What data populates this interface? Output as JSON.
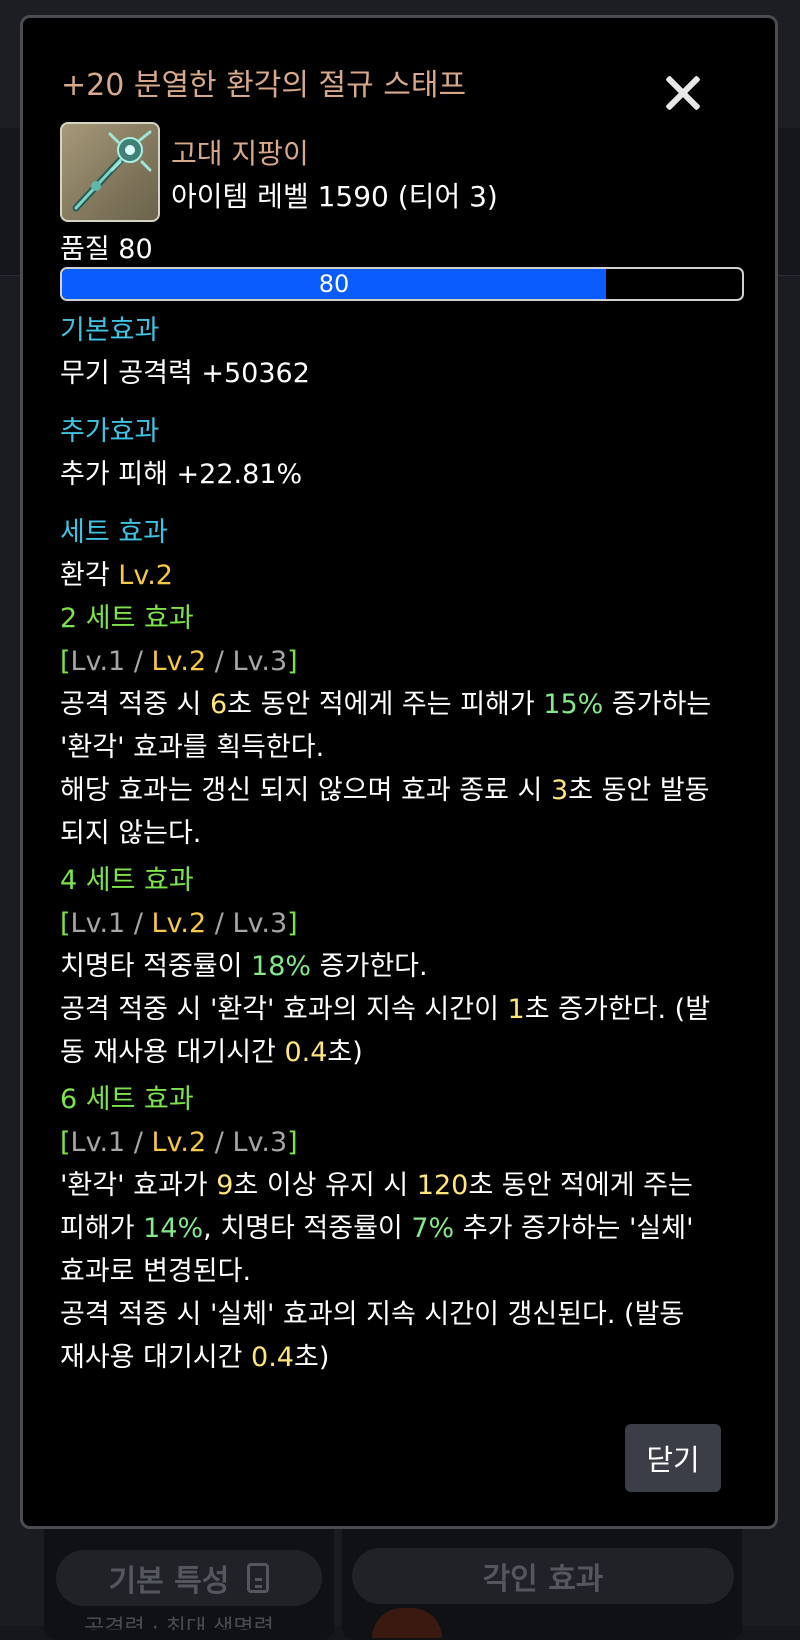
{
  "background": {
    "tab_basic_traits": "기본 특성",
    "tab_engraving": "각인 효과",
    "peek_text": "공격력 · 최대 생명력"
  },
  "tooltip": {
    "title": "+20 분열한 환각의 절규 스태프",
    "item_type": "고대 지팡이",
    "item_level": "아이템 레벨 1590 (티어 3)",
    "quality_label": "품질 80",
    "quality_value": "80",
    "quality_percent": 80,
    "basic_effect": {
      "title": "기본효과",
      "line": "무기 공격력 +50362"
    },
    "extra_effect": {
      "title": "추가효과",
      "line": "추가 피해 +22.81%"
    },
    "set_effect": {
      "title": "세트 효과",
      "set_name": "환각",
      "set_level": "Lv.2",
      "levels": {
        "open": "[",
        "lv1": "Lv.1",
        "sep": " / ",
        "lv2": "Lv.2",
        "lv3": "Lv.3",
        "close": "]"
      },
      "set2": {
        "title": "2 세트 효과",
        "t1": "공격 적중 시 ",
        "n1": "6",
        "t2": "초 동안 적에게 주는 피해가 ",
        "n2": "15%",
        "t3": " 증가하는",
        "t4": "'환각' 효과를 획득한다.",
        "t5": "해당 효과는 갱신 되지 않으며 효과 종료 시 ",
        "n3": "3",
        "t6": "초 동안 발동",
        "t7": "되지 않는다."
      },
      "set4": {
        "title": "4 세트 효과",
        "t1": "치명타 적중률이 ",
        "n1": "18%",
        "t2": " 증가한다.",
        "t3": "공격 적중 시 '환각' 효과의 지속 시간이 ",
        "n2": "1",
        "t4": "초 증가한다. (발",
        "t5": "동 재사용 대기시간 ",
        "n3": "0.4",
        "t6": "초)"
      },
      "set6": {
        "title": "6 세트 효과",
        "t1": "'환각' 효과가 ",
        "n1": "9",
        "t2": "초 이상 유지 시 ",
        "n2": "120",
        "t3": "초 동안 적에게 주는",
        "t4": "피해가 ",
        "n3": "14%",
        "t5": ", 치명타 적중률이 ",
        "n4": "7%",
        "t6": " 추가 증가하는 '실체'",
        "t7": "효과로 변경된다.",
        "t8": "공격 적중 시 '실체' 효과의 지속 시간이 갱신된다. (발동",
        "t9": "재사용 대기시간 ",
        "n5": "0.4",
        "t10": "초)"
      }
    },
    "close_button": "닫기"
  }
}
